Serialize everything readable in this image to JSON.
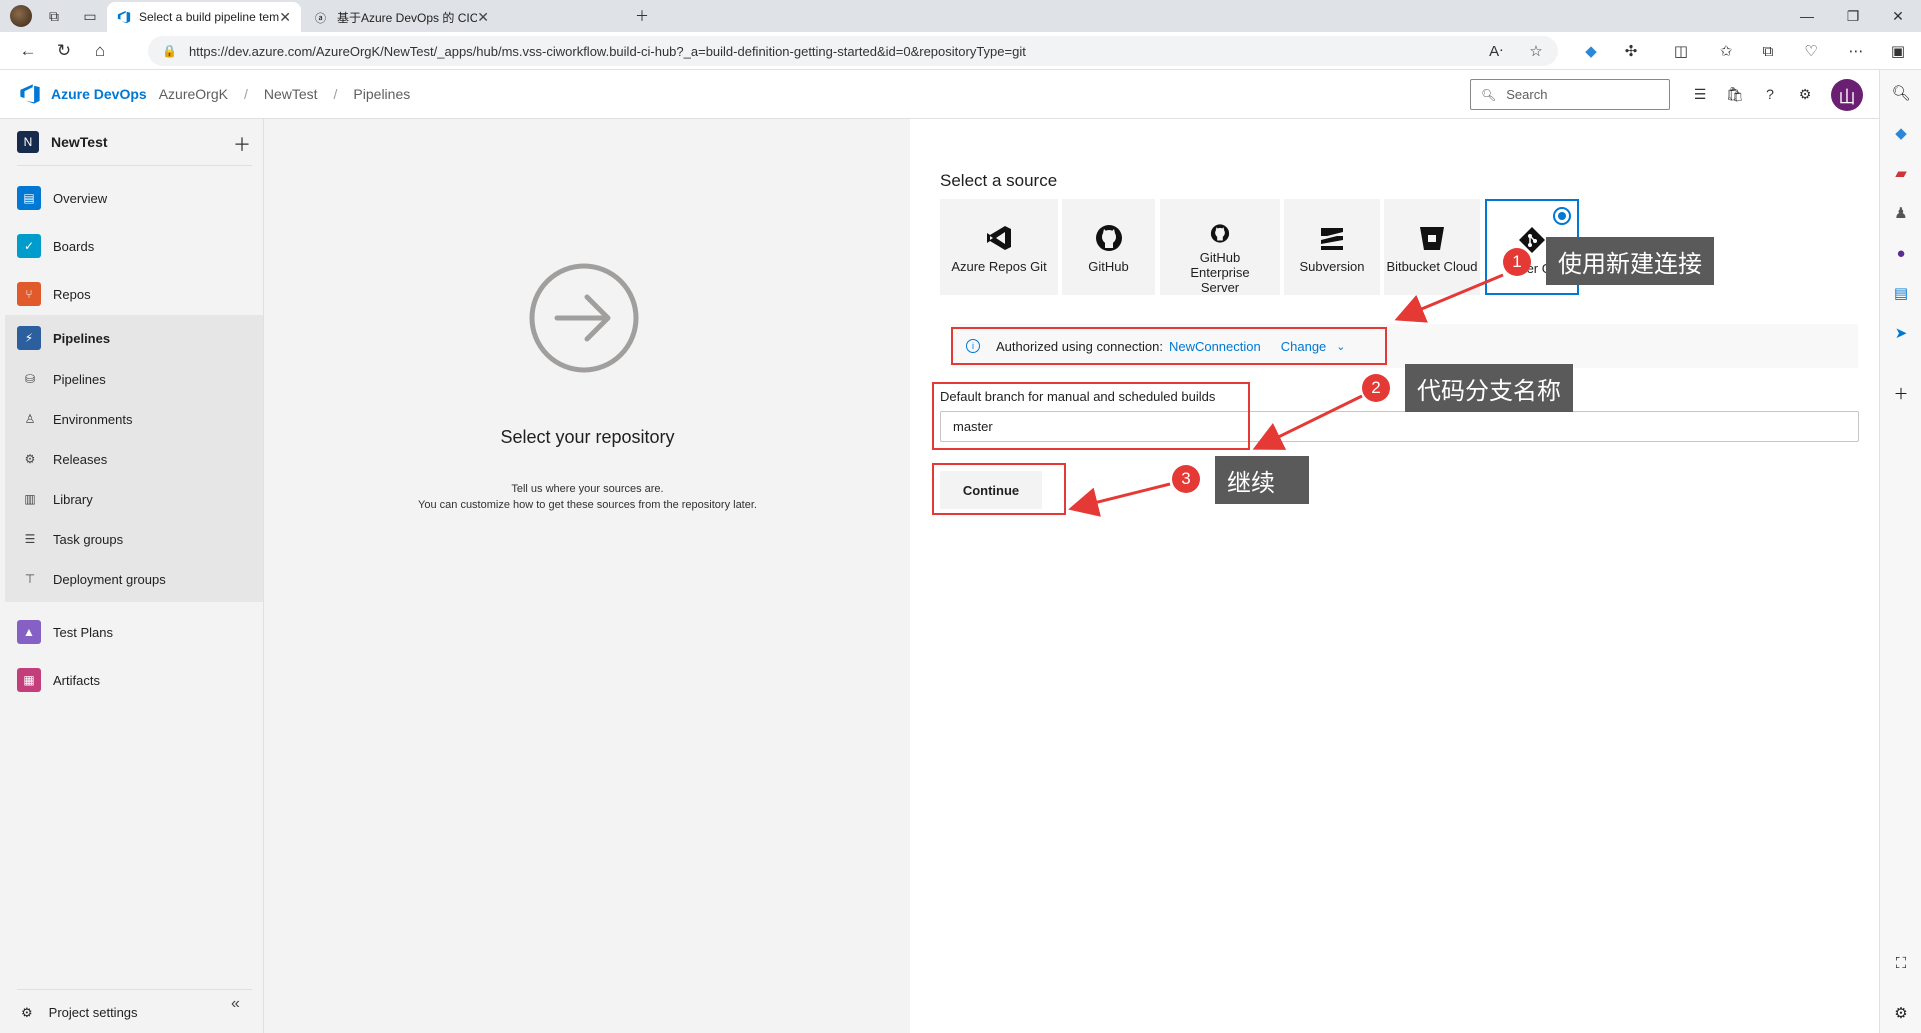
{
  "browser": {
    "tabs": [
      {
        "title": "Select a build pipeline template ·",
        "active": true
      },
      {
        "title": "基于Azure DevOps 的 CICD 项目",
        "active": false
      }
    ],
    "url": "https://dev.azure.com/AzureOrgK/NewTest/_apps/hub/ms.vss-ciworkflow.build-ci-hub?_a=build-definition-getting-started&id=0&repositoryType=git"
  },
  "header": {
    "brand": "Azure DevOps",
    "breadcrumbs": [
      "AzureOrgK",
      "NewTest",
      "Pipelines"
    ],
    "search_placeholder": "Search",
    "user_initial": "山",
    "accent": "#0078d4"
  },
  "sidebar": {
    "project": "NewTest",
    "project_initial": "N",
    "items": [
      {
        "label": "Overview",
        "color": "#0078d4"
      },
      {
        "label": "Boards",
        "color": "#009ccc"
      },
      {
        "label": "Repos",
        "color": "#e05a2b"
      },
      {
        "label": "Pipelines",
        "color": "#2c5f9e"
      },
      {
        "label": "Test Plans",
        "color": "#8661c5"
      },
      {
        "label": "Artifacts",
        "color": "#c43e7c"
      }
    ],
    "pipeline_subitems": [
      "Pipelines",
      "Environments",
      "Releases",
      "Library",
      "Task groups",
      "Deployment groups"
    ],
    "settings_label": "Project settings"
  },
  "left_pane": {
    "title": "Select your repository",
    "desc_line1": "Tell us where your sources are.",
    "desc_line2": "You can customize how to get these sources from the repository later."
  },
  "source": {
    "title": "Select a source",
    "tiles": [
      {
        "label": "Azure Repos Git",
        "icon": "azure-repos-icon"
      },
      {
        "label": "GitHub",
        "icon": "github-icon"
      },
      {
        "label": "GitHub Enterprise Server",
        "icon": "github-icon"
      },
      {
        "label": "Subversion",
        "icon": "subversion-icon"
      },
      {
        "label": "Bitbucket Cloud",
        "icon": "bitbucket-icon"
      },
      {
        "label": "Other Git",
        "icon": "git-icon",
        "selected": true
      }
    ],
    "auth_prefix": "Authorized using connection:",
    "connection": "NewConnection",
    "change": "Change",
    "branch_label": "Default branch for manual and scheduled builds",
    "branch_value": "master",
    "continue": "Continue"
  },
  "annotations": [
    {
      "num": "1",
      "text": "使用新建连接"
    },
    {
      "num": "2",
      "text": "代码分支名称"
    },
    {
      "num": "3",
      "text": "继续"
    }
  ]
}
